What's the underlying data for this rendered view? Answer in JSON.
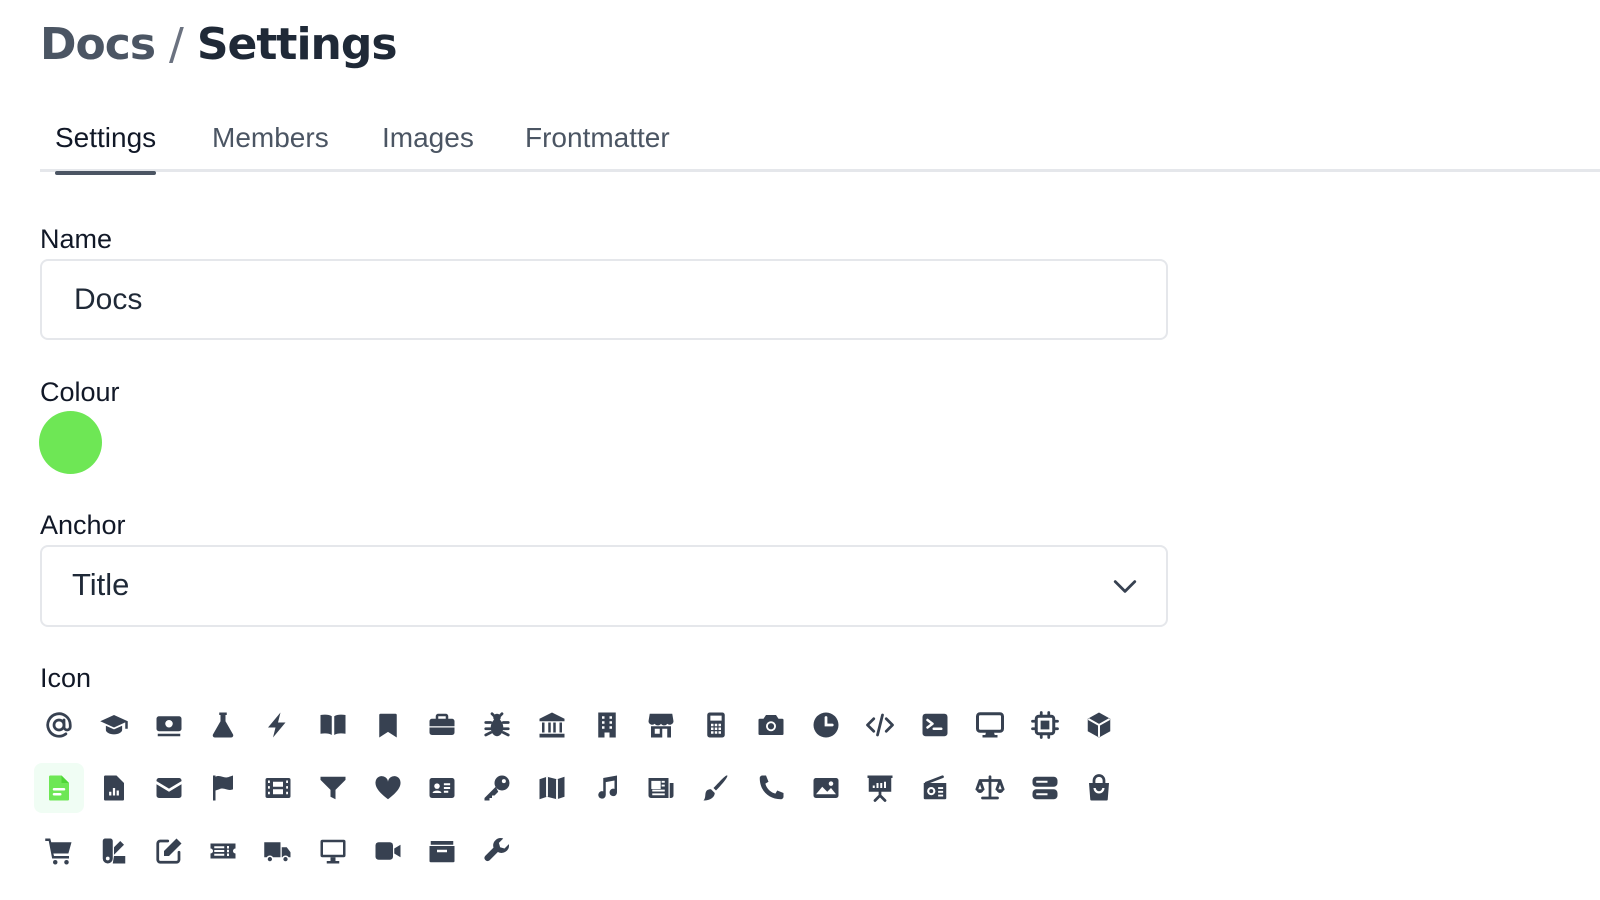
{
  "breadcrumb": {
    "parent": "Docs",
    "separator": "/",
    "current": "Settings"
  },
  "tabs": [
    {
      "label": "Settings",
      "active": true
    },
    {
      "label": "Members",
      "active": false
    },
    {
      "label": "Images",
      "active": false
    },
    {
      "label": "Frontmatter",
      "active": false
    }
  ],
  "name_field": {
    "label": "Name",
    "value": "Docs"
  },
  "colour_field": {
    "label": "Colour",
    "value": "#6ee755"
  },
  "anchor_field": {
    "label": "Anchor",
    "value": "Title"
  },
  "icon_field": {
    "label": "Icon",
    "selected": "document-icon",
    "selected_color": "#6ee755",
    "icons": [
      "at-icon",
      "graduation-cap-icon",
      "money-icon",
      "flask-icon",
      "bolt-icon",
      "book-open-icon",
      "bookmark-icon",
      "briefcase-icon",
      "bug-icon",
      "bank-icon",
      "building-icon",
      "store-icon",
      "calculator-icon",
      "camera-icon",
      "clock-icon",
      "code-icon",
      "terminal-icon",
      "desktop-icon",
      "chip-icon",
      "cube-icon",
      "document-icon",
      "document-chart-icon",
      "envelope-icon",
      "flag-icon",
      "film-icon",
      "funnel-icon",
      "heart-icon",
      "id-card-icon",
      "key-icon",
      "map-icon",
      "music-icon",
      "newspaper-icon",
      "paint-brush-icon",
      "phone-icon",
      "photo-icon",
      "presentation-icon",
      "radio-icon",
      "scale-icon",
      "server-icon",
      "shopping-bag-icon",
      "shopping-cart-icon",
      "swatch-icon",
      "pencil-square-icon",
      "ticket-icon",
      "truck-icon",
      "monitor-icon",
      "video-camera-icon",
      "wallet-icon",
      "wrench-icon"
    ]
  }
}
